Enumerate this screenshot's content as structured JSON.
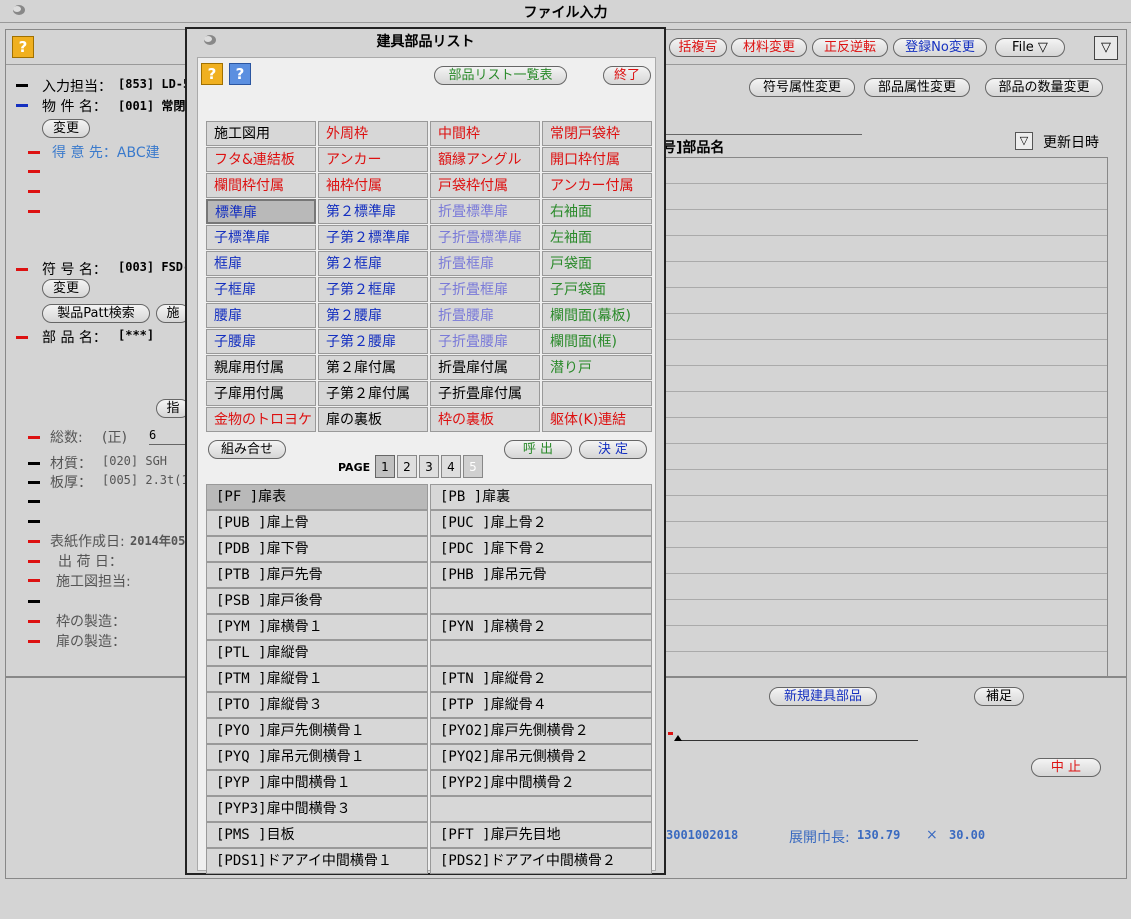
{
  "window": {
    "title": "ファイル入力"
  },
  "toolbar": {
    "btn_fukusha": "括複写",
    "btn_zairyo": "材料変更",
    "btn_seihan": "正反逆転",
    "btn_toroku": "登録No変更",
    "btn_file": "File ▽",
    "menu_icon": "▽"
  },
  "left": {
    "nyuryoku_label": "入力担当：",
    "nyuryoku_value": "[853] LD-5",
    "bukken_label": "物 件 名：",
    "bukken_value": "[001] 常閉",
    "henko1": "変更",
    "tokuisaki": "得 意 先：ABC建",
    "fugo_label": "符 号 名：",
    "fugo_value": "[003] FSD-",
    "henko2": "変更",
    "seihin_btn": "製品Patt検索",
    "seko_btn": "施",
    "buhin_label": "部 品 名：",
    "buhin_value": "[***]",
    "shitei_btn": "指",
    "sosu_label": "総数:",
    "sosu_sei": "(正)",
    "sosu_value": "6",
    "zaishitsu_label": "材質：",
    "zaishitsu_value": "[020] SGH",
    "itaatsu_label": "板厚：",
    "itaatsu_value": "[005] 2.3t(1.",
    "hyoshi_label": "表紙作成日:",
    "hyoshi_value": "2014年05",
    "shukka_label": "出 荷 日：",
    "sekozu_label": "施工図担当:",
    "waku_label": "枠の製造：",
    "tobira_label": "扉の製造："
  },
  "right": {
    "fugo_zokusei": "符号属性変更",
    "buhin_zokusei": "部品属性変更",
    "buhin_suryo": "部品の数量変更",
    "column_header": "号]部品名",
    "sort_icon": "▽",
    "koshin": "更新日時",
    "shinki": "新規建具部品",
    "hosoku": "補足",
    "chushi": "中 止",
    "code_value": "3001002018",
    "tenkai_label": "展開巾長:",
    "tenkai_w": "130.79",
    "times": "×",
    "tenkai_h": "30.00"
  },
  "dialog": {
    "title": "建具部品リスト",
    "help_icon": "?",
    "help2_icon": "?",
    "ichiran_btn": "部品リスト一覧表",
    "shuryo_btn": "終了",
    "kumiawase_btn": "組み合せ",
    "yobidashi_btn": "呼 出",
    "kettei_btn": "決 定",
    "page_label": "PAGE",
    "pages": [
      "1",
      "2",
      "3",
      "4",
      "5"
    ],
    "categories": [
      [
        "施工図用",
        "外周枠",
        "中間枠",
        "常閉戸袋枠"
      ],
      [
        "フタ&連結板",
        "アンカー",
        "額縁アングル",
        "開口枠付属"
      ],
      [
        "欄間枠付属",
        "袖枠付属",
        "戸袋枠付属",
        "アンカー付属"
      ],
      [
        "標準扉",
        "第２標準扉",
        "折畳標準扉",
        "右袖面"
      ],
      [
        "子標準扉",
        "子第２標準扉",
        "子折畳標準扉",
        "左袖面"
      ],
      [
        "框扉",
        "第２框扉",
        "折畳框扉",
        "戸袋面"
      ],
      [
        "子框扉",
        "子第２框扉",
        "子折畳框扉",
        "子戸袋面"
      ],
      [
        "腰扉",
        "第２腰扉",
        "折畳腰扉",
        "欄間面(幕板)"
      ],
      [
        "子腰扉",
        "子第２腰扉",
        "子折畳腰扉",
        "欄間面(框)"
      ],
      [
        "親扉用付属",
        "第２扉付属",
        "折畳扉付属",
        "潜り戸"
      ],
      [
        "子扉用付属",
        "子第２扉付属",
        "子折畳扉付属",
        ""
      ],
      [
        "金物のトロヨケ",
        "扉の裏板",
        "枠の裏板",
        "躯体(K)連結"
      ]
    ],
    "parts": [
      [
        "[PF  ]扉表",
        "[PB  ]扉裏"
      ],
      [
        "[PUB ]扉上骨",
        "[PUC ]扉上骨２"
      ],
      [
        "[PDB ]扉下骨",
        "[PDC ]扉下骨２"
      ],
      [
        "[PTB ]扉戸先骨",
        "[PHB ]扉吊元骨"
      ],
      [
        "[PSB ]扉戸後骨",
        ""
      ],
      [
        "[PYM ]扉横骨１",
        "[PYN ]扉横骨２"
      ],
      [
        "[PTL ]扉縦骨",
        ""
      ],
      [
        "[PTM ]扉縦骨１",
        "[PTN ]扉縦骨２"
      ],
      [
        "[PTO ]扉縦骨３",
        "[PTP ]扉縦骨４"
      ],
      [
        "[PYO ]扉戸先側横骨１",
        "[PYO2]扉戸先側横骨２"
      ],
      [
        "[PYQ ]扉吊元側横骨１",
        "[PYQ2]扉吊元側横骨２"
      ],
      [
        "[PYP ]扉中間横骨１",
        "[PYP2]扉中間横骨２"
      ],
      [
        "[PYP3]扉中間横骨３",
        ""
      ],
      [
        "[PMS ]目板",
        "[PFT ]扉戸先目地"
      ],
      [
        "[PDS1]ドアアイ中間横骨１",
        "[PDS2]ドアアイ中間横骨２"
      ]
    ]
  },
  "colors": {
    "red": "#d11111",
    "blue": "#1530c0",
    "green": "#2a8a2a",
    "lightblue": "#7a7ad8",
    "accent_orange": "#f0b020"
  }
}
